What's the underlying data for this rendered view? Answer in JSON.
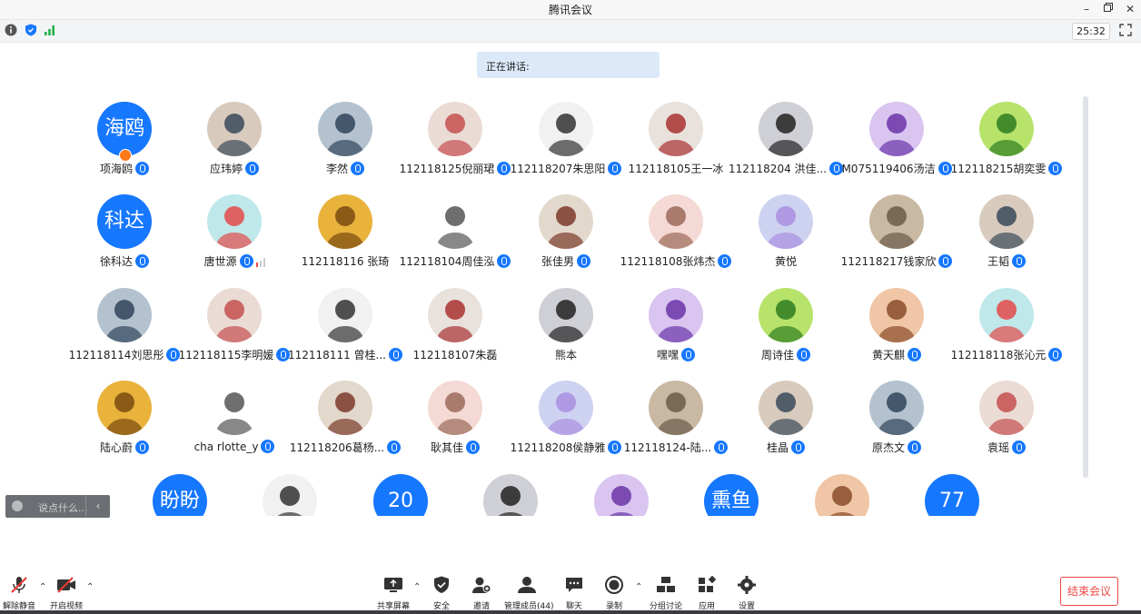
{
  "window": {
    "title": "腾讯会议",
    "minimize_icon": "minimize-icon",
    "restore_icon": "restore-icon",
    "close_icon": "close-icon"
  },
  "status_bar": {
    "timer": "25:32",
    "info_icon": "info-icon",
    "security_icon": "shield-icon",
    "signal_icon": "signal-icon",
    "fullscreen_icon": "fullscreen-icon"
  },
  "speaking": {
    "label": "正在讲话:"
  },
  "participants": [
    {
      "name": "项海鸥",
      "avatar_text": "海鸥",
      "host": true
    },
    {
      "name": "应玮婷",
      "avatar_photo": true
    },
    {
      "name": "李然",
      "avatar_photo": true
    },
    {
      "name": "112118125倪丽珺",
      "avatar_photo": true
    },
    {
      "name": "112118207朱思阳",
      "avatar_photo": true
    },
    {
      "name": "112118105王一冰",
      "avatar_photo": true,
      "no_mic": true
    },
    {
      "name": "112118204 洪佳...",
      "avatar_photo": true
    },
    {
      "name": "M075119406汤洁",
      "avatar_photo": true
    },
    {
      "name": "112118215胡奕雯",
      "avatar_photo": true
    },
    {
      "name": "徐科达",
      "avatar_text": "科达"
    },
    {
      "name": "唐世源",
      "avatar_photo": true,
      "speaking": true
    },
    {
      "name": "112118116 张琦",
      "avatar_photo": true,
      "no_mic": true
    },
    {
      "name": "112118104周佳泓",
      "avatar_photo": true
    },
    {
      "name": "张佳男",
      "avatar_photo": true
    },
    {
      "name": "112118108张炜杰",
      "avatar_photo": true
    },
    {
      "name": "黄悦",
      "avatar_photo": true,
      "no_mic": true
    },
    {
      "name": "112118217钱家欣",
      "avatar_photo": true
    },
    {
      "name": "王韬",
      "avatar_photo": true
    },
    {
      "name": "112118114刘思彤",
      "avatar_photo": true
    },
    {
      "name": "112118115李明媛",
      "avatar_photo": true
    },
    {
      "name": "112118111 曾桂...",
      "avatar_photo": true
    },
    {
      "name": "112118107朱磊",
      "avatar_photo": true,
      "no_mic": true
    },
    {
      "name": "熊本",
      "avatar_photo": true,
      "no_mic": true
    },
    {
      "name": "嘿嘿",
      "avatar_photo": true
    },
    {
      "name": "周诗佳",
      "avatar_photo": true
    },
    {
      "name": "黄天麒",
      "avatar_photo": true
    },
    {
      "name": "112118118张沁元",
      "avatar_photo": true
    },
    {
      "name": "陆心蔚",
      "avatar_photo": true
    },
    {
      "name": "cha rlotte_y",
      "avatar_photo": true
    },
    {
      "name": "112118206葛杨...",
      "avatar_photo": true
    },
    {
      "name": "耿其佳",
      "avatar_photo": true
    },
    {
      "name": "112118208侯静雅",
      "avatar_photo": true
    },
    {
      "name": "112118124-陆...",
      "avatar_photo": true
    },
    {
      "name": "桂晶",
      "avatar_photo": true
    },
    {
      "name": "原杰文",
      "avatar_photo": true
    },
    {
      "name": "袁瑶",
      "avatar_photo": true
    }
  ],
  "partial_row": [
    {
      "avatar_text": "盼盼"
    },
    {
      "avatar_photo": true
    },
    {
      "avatar_text": "20"
    },
    {
      "avatar_photo": true
    },
    {
      "avatar_photo": true
    },
    {
      "avatar_text": "熏鱼"
    },
    {
      "avatar_photo": true
    },
    {
      "avatar_text": "77"
    }
  ],
  "chat": {
    "placeholder": "说点什么...",
    "collapse_icon": "chevron-left-icon"
  },
  "toolbar": {
    "unmute": "解除静音",
    "start_video": "开启视频",
    "share_screen": "共享屏幕",
    "security": "安全",
    "invite": "邀请",
    "manage_members": "管理成员(44)",
    "chat": "聊天",
    "record": "录制",
    "breakout": "分组讨论",
    "apps": "应用",
    "settings": "设置",
    "end_meeting": "结束会议"
  },
  "colors": {
    "accent": "#1677ff",
    "danger": "#f04747",
    "banner": "#dce9f8"
  }
}
